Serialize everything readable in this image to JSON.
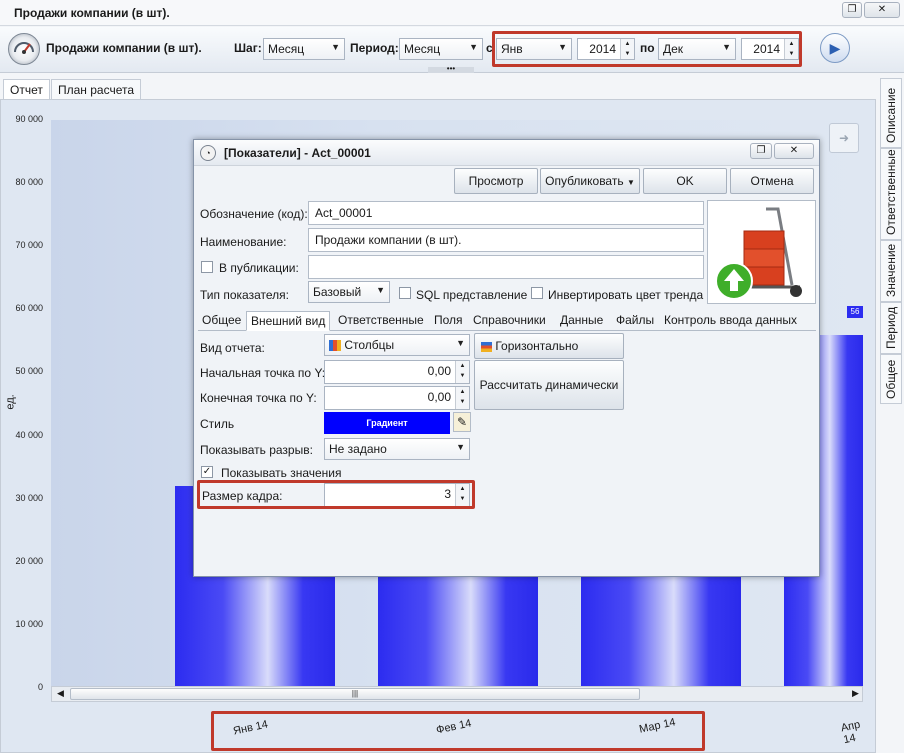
{
  "window": {
    "title": "Продажи компании (в шт)."
  },
  "toolbar": {
    "report_title": "Продажи компании (в шт).",
    "step_label": "Шаг:",
    "step_value": "Месяц",
    "period_label": "Период:",
    "period_value": "Месяц",
    "from_label": "с",
    "from_month": "Янв",
    "from_year": "2014",
    "to_label": "по",
    "to_month": "Дек",
    "to_year": "2014"
  },
  "tabs": [
    "Отчет",
    "План расчета"
  ],
  "side_tabs": [
    "Описание",
    "Ответственные",
    "Значение",
    "Период",
    "Общее"
  ],
  "chart_data": {
    "type": "bar",
    "ylabel": "ед.",
    "yticks": [
      "90 000",
      "80 000",
      "70 000",
      "60 000",
      "50 000",
      "40 000",
      "30 000",
      "20 000",
      "10 000",
      "0"
    ],
    "categories": [
      "Янв 14",
      "Фев 14",
      "Мар 14",
      "Апр 14"
    ],
    "values": [
      32000,
      32000,
      32000,
      56000
    ],
    "value_label": "56",
    "ylim": [
      0,
      90000
    ]
  },
  "dialog": {
    "title": "[Показатели] - Act_00001",
    "buttons": {
      "preview": "Просмотр",
      "publish": "Опубликовать",
      "ok": "OK",
      "cancel": "Отмена"
    },
    "code_label": "Обозначение (код):",
    "code_value": "Act_00001",
    "name_label": "Наименование:",
    "name_value": "Продажи компании (в шт).",
    "publish_label": "В публикации:",
    "type_label": "Тип показателя:",
    "type_value": "Базовый",
    "sql_label": "SQL представление",
    "invert_label": "Инвертировать цвет тренда",
    "tabs": [
      "Общее",
      "Внешний вид",
      "Ответственные",
      "Поля",
      "Справочники",
      "Данные",
      "Файлы",
      "Контроль ввода данных"
    ],
    "view_label": "Вид отчета:",
    "view_value": "Столбцы",
    "horizontal_label": "Горизонтально",
    "start_y_label": "Начальная точка по Y:",
    "start_y_value": "0,00",
    "end_y_label": "Конечная точка по Y:",
    "end_y_value": "0,00",
    "calc_label": "Рассчитать динамически",
    "style_label": "Стиль",
    "style_value": "Градиент",
    "gap_label": "Показывать разрыв:",
    "gap_value": "Не задано",
    "show_values_label": "Показывать значения",
    "frame_label": "Размер кадра:",
    "frame_value": "3"
  },
  "colors": {
    "accent_red": "#c0392b",
    "bar_blue": "#2c2cf0",
    "style_swatch": "#0000ff"
  }
}
